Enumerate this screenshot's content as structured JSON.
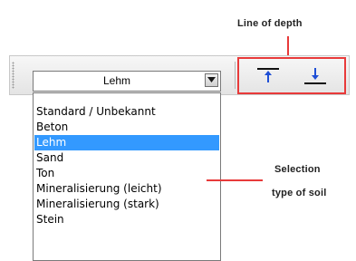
{
  "annotations": {
    "depth_label": "Line of depth",
    "soil_label_line1": "Selection",
    "soil_label_line2": "type of soil"
  },
  "soil_combo": {
    "selected_value": "Lehm",
    "options": [
      "Standard / Unbekannt",
      "Beton",
      "Lehm",
      "Sand",
      "Ton",
      "Mineralisierung (leicht)",
      "Mineralisierung (stark)",
      "Stein"
    ],
    "selected_index": 2
  },
  "depth_buttons": [
    {
      "icon": "depth-line-top-arrow-up-icon"
    },
    {
      "icon": "depth-line-bottom-arrow-down-icon"
    }
  ],
  "colors": {
    "annotation_red": "#e83a3a",
    "selection_blue": "#3399ff"
  }
}
